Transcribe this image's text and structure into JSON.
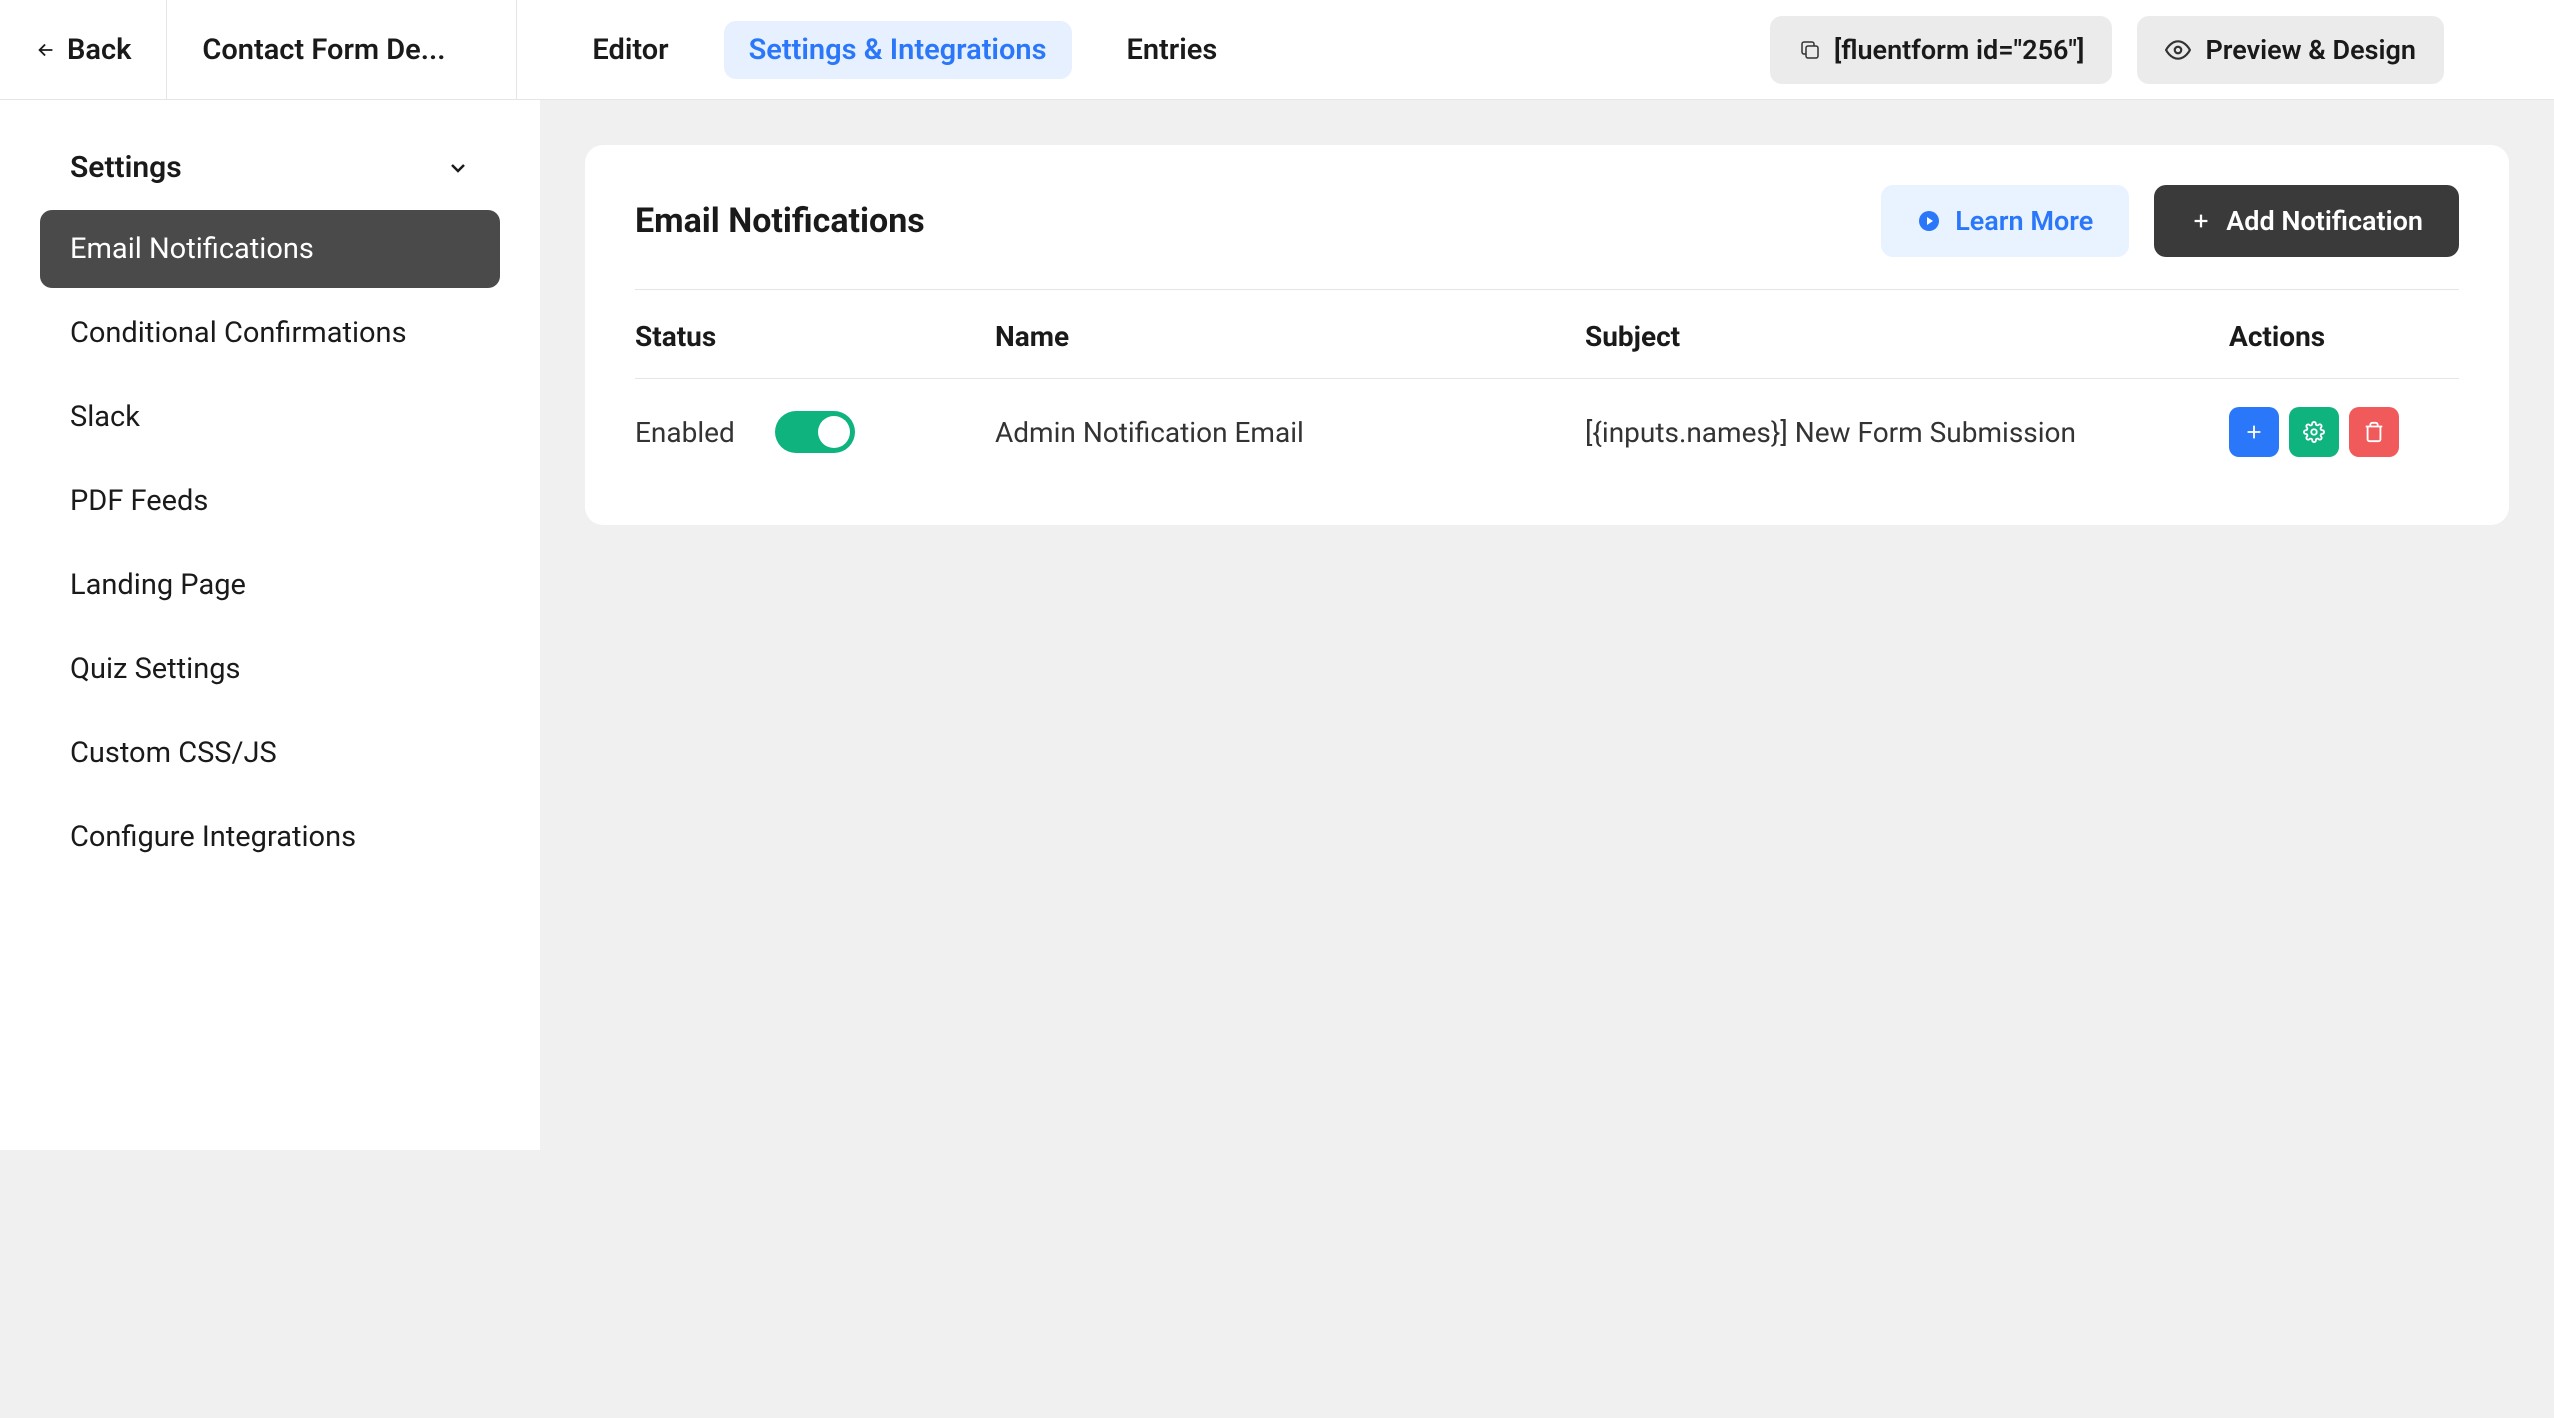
{
  "header": {
    "back": "Back",
    "form_title": "Contact Form De...",
    "tabs": {
      "editor": "Editor",
      "settings": "Settings & Integrations",
      "entries": "Entries"
    },
    "shortcode": "[fluentform id=\"256\"]",
    "preview": "Preview & Design"
  },
  "sidebar": {
    "header": "Settings",
    "items": [
      "Email Notifications",
      "Conditional Confirmations",
      "Slack",
      "PDF Feeds",
      "Landing Page",
      "Quiz Settings",
      "Custom CSS/JS",
      "Configure Integrations"
    ]
  },
  "card": {
    "title": "Email Notifications",
    "learn_more": "Learn More",
    "add_notification": "Add Notification",
    "columns": {
      "status": "Status",
      "name": "Name",
      "subject": "Subject",
      "actions": "Actions"
    },
    "row": {
      "status_label": "Enabled",
      "status_enabled": true,
      "name": "Admin Notification Email",
      "subject": "[{inputs.names}] New Form Submission"
    }
  }
}
